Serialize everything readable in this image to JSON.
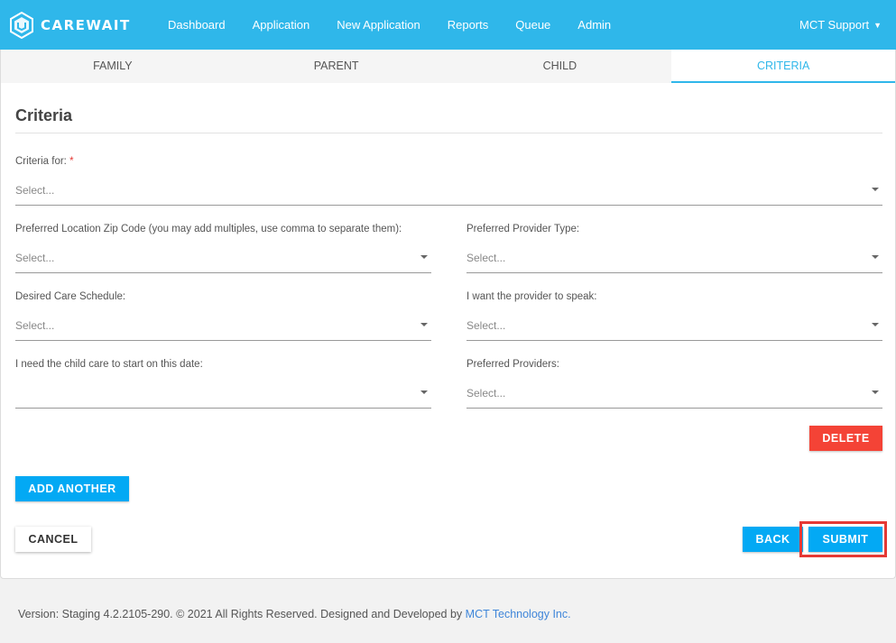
{
  "brand": {
    "name": "CAREWAIT",
    "logo_icon": "carewait-logo-icon"
  },
  "nav": {
    "items": [
      {
        "label": "Dashboard"
      },
      {
        "label": "Application"
      },
      {
        "label": "New Application"
      },
      {
        "label": "Reports"
      },
      {
        "label": "Queue"
      },
      {
        "label": "Admin"
      }
    ],
    "user": {
      "label": "MCT Support",
      "caret": "▼"
    }
  },
  "tabs": [
    {
      "label": "FAMILY"
    },
    {
      "label": "PARENT"
    },
    {
      "label": "CHILD"
    },
    {
      "label": "CRITERIA",
      "active": true
    }
  ],
  "form": {
    "title": "Criteria",
    "criteria_for": {
      "label": "Criteria for:",
      "required_mark": "*",
      "value": "Select..."
    },
    "zip": {
      "label": "Preferred Location Zip Code (you may add multiples, use comma to separate them):",
      "value": "Select..."
    },
    "provider_type": {
      "label": "Preferred Provider Type:",
      "value": "Select..."
    },
    "schedule": {
      "label": "Desired Care Schedule:",
      "value": "Select..."
    },
    "language": {
      "label": "I want the provider to speak:",
      "value": "Select..."
    },
    "start_date": {
      "label": "I need the child care to start on this date:",
      "value": ""
    },
    "providers": {
      "label": "Preferred Providers:",
      "value": "Select..."
    }
  },
  "buttons": {
    "delete": "DELETE",
    "add_another": "ADD ANOTHER",
    "cancel": "CANCEL",
    "back": "BACK",
    "submit": "SUBMIT"
  },
  "footer": {
    "text": "Version: Staging 4.2.2105-290. © 2021 All Rights Reserved. Designed and Developed by ",
    "link": "MCT Technology Inc."
  },
  "colors": {
    "navbar": "#2fb7ea",
    "primary_button": "#03a9f4",
    "delete_button": "#f44336",
    "highlight_box": "#e53935",
    "link": "#3f86d9"
  }
}
